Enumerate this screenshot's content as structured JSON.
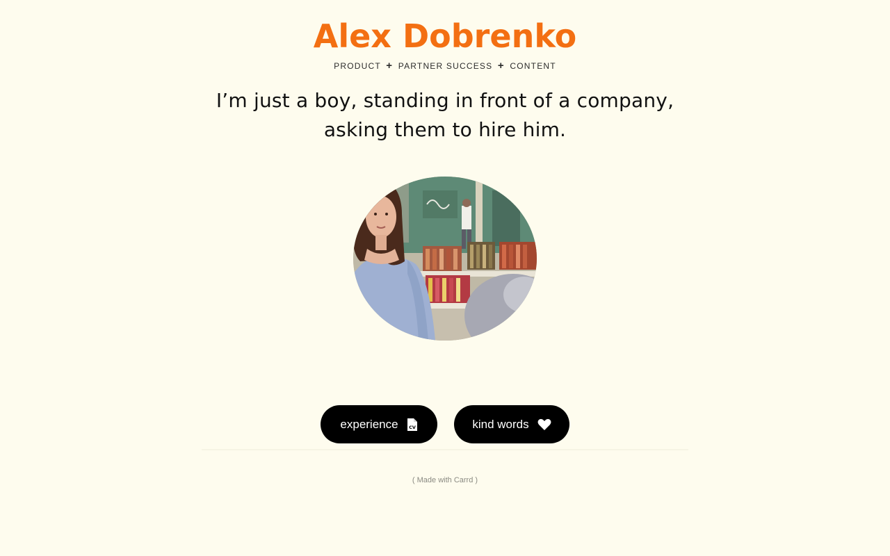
{
  "header": {
    "name": "Alex Dobrenko",
    "tagline": {
      "part1": "PRODUCT",
      "sep1": "+",
      "part2": "PARTNER SUCCESS",
      "sep2": "+",
      "part3": "CONTENT"
    }
  },
  "headline": {
    "line1": "I’m just a boy, standing in front of a company,",
    "line2": "asking them to hire him."
  },
  "photo": {
    "alt": "profile photo"
  },
  "buttons": {
    "experience": {
      "label": "experience",
      "icon": "cv-document-icon"
    },
    "kind_words": {
      "label": "kind words",
      "icon": "heart-icon"
    }
  },
  "footer": {
    "text": "( Made with Carrd )"
  },
  "colors": {
    "background": "#fefcee",
    "accent": "#f36f12",
    "button": "#000000"
  }
}
